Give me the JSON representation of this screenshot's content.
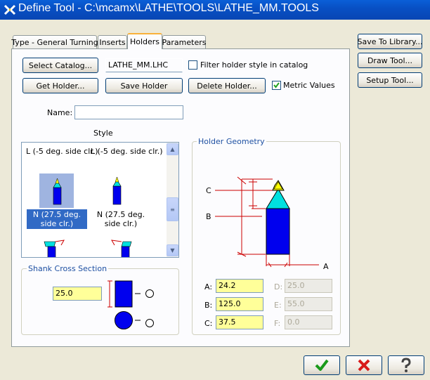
{
  "window": {
    "title": "Define Tool - C:\\mcamx\\LATHE\\TOOLS\\LATHE_MM.TOOLS"
  },
  "tabs": [
    {
      "label": "Type - General Turning"
    },
    {
      "label": "Inserts"
    },
    {
      "label": "Holders"
    },
    {
      "label": "Parameters"
    }
  ],
  "side_buttons": {
    "save_to_library": "Save To Library...",
    "draw_tool": "Draw Tool...",
    "setup_tool": "Setup Tool..."
  },
  "holders": {
    "select_catalog": "Select Catalog...",
    "catalog_value": "LATHE_MM.LHC",
    "filter_label": "Filter holder style in catalog",
    "filter_checked": false,
    "get_holder": "Get Holder...",
    "save_holder": "Save Holder",
    "delete_holder": "Delete Holder...",
    "metric_label": "Metric Values",
    "metric_checked": true,
    "name_label": "Name:",
    "name_value": "",
    "style_label": "Style",
    "style_items": [
      {
        "label": "L (-5 deg. side clr.)"
      },
      {
        "label": "L (-5 deg. side clr.)"
      },
      {
        "label": "N (27.5 deg. side clr.)",
        "selected": true
      },
      {
        "label": "N (27.5 deg. side clr.)"
      }
    ],
    "shank_title": "Shank Cross Section",
    "shank_value": "25.0",
    "geometry_title": "Holder Geometry",
    "dims": {
      "label_c": "C",
      "label_b": "B",
      "label_a": "A"
    },
    "params": {
      "a_label": "A:",
      "a_value": "24.2",
      "b_label": "B:",
      "b_value": "125.0",
      "c_label": "C:",
      "c_value": "37.5",
      "d_label": "D:",
      "d_value": "25.0",
      "e_label": "E:",
      "e_value": "55.0",
      "f_label": "F:",
      "f_value": "0.0"
    }
  },
  "footer": {
    "ok_icon": "check-icon",
    "cancel_icon": "x-icon",
    "help_icon": "question-icon"
  },
  "colors": {
    "titlebar": "#0a5fd8",
    "tool_blue": "#0000ee",
    "insert_yellow": "#ffff00",
    "insert_cyan": "#00e0e0",
    "dim_red": "#cc0000",
    "field_yellow": "#ffff99"
  }
}
